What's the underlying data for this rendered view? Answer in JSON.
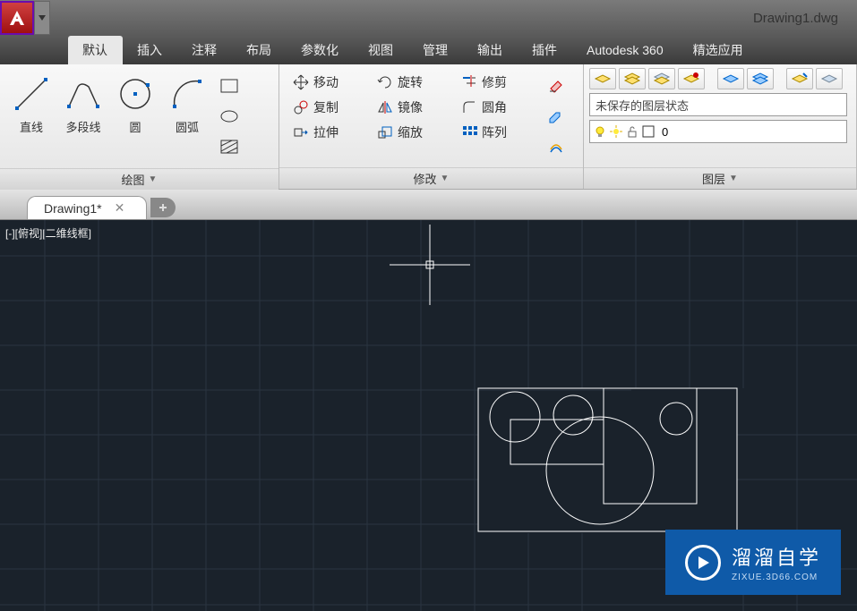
{
  "title": "Drawing1.dwg",
  "menu": [
    "默认",
    "插入",
    "注释",
    "布局",
    "参数化",
    "视图",
    "管理",
    "输出",
    "插件",
    "Autodesk 360",
    "精选应用"
  ],
  "activeMenuIndex": 0,
  "panels": {
    "draw": {
      "title": "绘图",
      "tools": [
        "直线",
        "多段线",
        "圆",
        "圆弧"
      ]
    },
    "modify": {
      "title": "修改",
      "row1": [
        {
          "label": "移动",
          "icon": "move"
        },
        {
          "label": "旋转",
          "icon": "rotate"
        },
        {
          "label": "修剪",
          "icon": "trim"
        }
      ],
      "row2": [
        {
          "label": "复制",
          "icon": "copy"
        },
        {
          "label": "镜像",
          "icon": "mirror"
        },
        {
          "label": "圆角",
          "icon": "fillet"
        }
      ],
      "row3": [
        {
          "label": "拉伸",
          "icon": "stretch"
        },
        {
          "label": "缩放",
          "icon": "scale"
        },
        {
          "label": "阵列",
          "icon": "array"
        }
      ]
    },
    "layer": {
      "title": "图层",
      "state": "未保存的图层状态",
      "current": "0"
    }
  },
  "tab": {
    "name": "Drawing1*"
  },
  "viewLabel": "[-][俯视][二维线框]",
  "watermark": {
    "main": "溜溜自学",
    "sub": "ZIXUE.3D66.COM"
  }
}
